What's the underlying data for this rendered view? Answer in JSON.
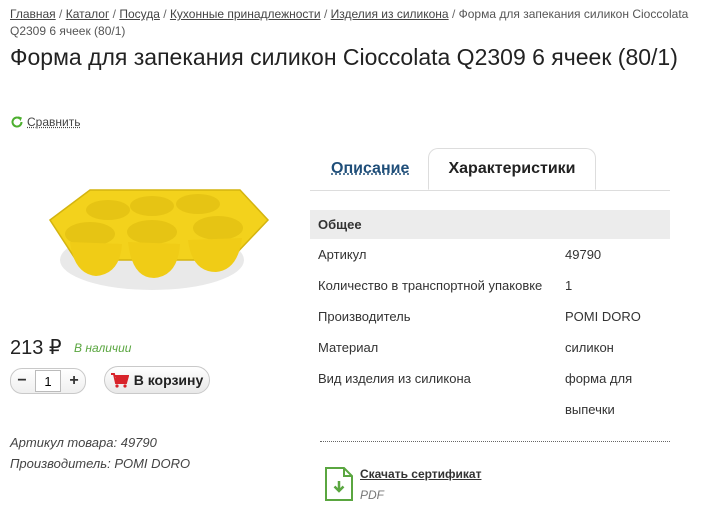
{
  "breadcrumb": {
    "items": [
      "Главная",
      "Каталог",
      "Посуда",
      "Кухонные принадлежности",
      "Изделия из силикона"
    ],
    "current": "Форма для запекания силикон Cioccolata Q2309 6 ячеек (80/1)"
  },
  "product": {
    "title": "Форма для запекания силикон Cioccolata Q2309 6 ячеек (80/1)",
    "compare_label": "Сравнить",
    "price": "213 ₽",
    "stock": "В наличии",
    "quantity": "1",
    "cart_label": "В корзину",
    "sku_line": "Артикул товара: 49790",
    "maker_line": "Производитель: POMI DORO"
  },
  "tabs": {
    "description": "Описание",
    "characteristics": "Характеристики"
  },
  "specs": {
    "section": "Общее",
    "rows": [
      {
        "key": "Артикул",
        "value": "49790"
      },
      {
        "key": "Количество в транспортной упаковке",
        "value": "1"
      },
      {
        "key": "Производитель",
        "value": "POMI DORO"
      },
      {
        "key": "Материал",
        "value": "силикон"
      },
      {
        "key": "Вид изделия из силикона",
        "value": "форма для",
        "value2": "выпечки"
      }
    ]
  },
  "certificate": {
    "link": "Скачать сертификат",
    "format": "PDF"
  },
  "colors": {
    "accent_green": "#5aa640",
    "link_blue": "#1f4e79",
    "product_yellow": "#f3d21c",
    "cart_red": "#d8232a"
  }
}
